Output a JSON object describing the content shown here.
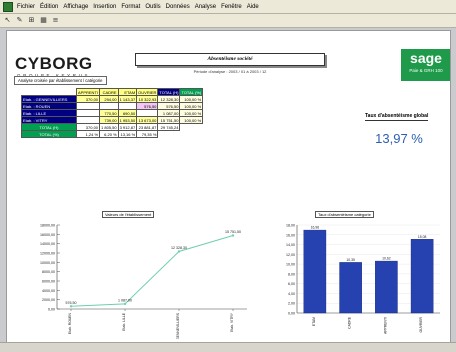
{
  "menu": {
    "items": [
      "Fichier",
      "Édition",
      "Affichage",
      "Insertion",
      "Format",
      "Outils",
      "Données",
      "Analyse",
      "Fenêtre",
      "Aide"
    ]
  },
  "toolbar": {
    "icons": [
      "pointer-icon",
      "draw-icon",
      "crop-icon",
      "grid-icon",
      "format-icon"
    ]
  },
  "logo": {
    "main": "CYBORG",
    "sub": "GROUPE KEYRUS"
  },
  "subtitle_box": "Analyse croisée par établissement / catégorie",
  "title": "Absentéisme société",
  "period": "Période d'analyse : 2003 / 01 à 2003 / 12",
  "sage": {
    "brand": "sage",
    "sub": "Paie & GRH 100"
  },
  "table": {
    "headers": [
      "APPRENTI",
      "CADRE",
      "ETAM",
      "OUVRIER",
      "TOTAL (H)",
      "TOTAL (%)"
    ],
    "rows": [
      {
        "label": "Etab. : GENNEVILLIERS",
        "cells": [
          "370,00",
          "294,00",
          "1 143,37",
          "10 322,93",
          "12 328,30",
          "100,00 %"
        ]
      },
      {
        "label": "Etab. : ROUEN",
        "cells": [
          "",
          "",
          "",
          "576,50",
          "576,50",
          "100,00 %"
        ]
      },
      {
        "label": "Etab. : LILLE",
        "cells": [
          "",
          "770,50",
          "690,50",
          "",
          "1 087,00",
          "100,00 %"
        ]
      },
      {
        "label": "Etab. : VITRY",
        "cells": [
          "",
          "739,00",
          "1 953,50",
          "13 673,00",
          "15 751,50",
          "100,00 %"
        ]
      }
    ],
    "total_h": {
      "label": "TOTAL (H)",
      "cells": [
        "370,00",
        "1 805,50",
        "3 912,87",
        "23 881,87",
        "29 745,24"
      ]
    },
    "total_pct": {
      "label": "TOTAL (%)",
      "cells": [
        "1,24 %",
        "6,20 %",
        "13,16 %",
        "79,35 %"
      ]
    }
  },
  "taux": {
    "label": "Taux d'absentéisme global",
    "value": "13,97 %"
  },
  "chart_data": [
    {
      "type": "line",
      "title": "Valeurs de l'établissement",
      "categories": [
        "Etab. ROUEN",
        "Etab. LILLE",
        "Etab. GENNEVILLIERS",
        "Etab. VITRY"
      ],
      "values": [
        576.5,
        1087,
        12328.3,
        15751.5
      ],
      "data_labels": [
        "576,50",
        "1 087,00",
        "12 328,30",
        "15 751,50"
      ],
      "yticks": [
        "18000,00",
        "16000,00",
        "14000,00",
        "12000,00",
        "10000,00",
        "8000,00",
        "6000,00",
        "4000,00",
        "2000,00",
        "0,00"
      ],
      "ylim": [
        0,
        18000
      ],
      "color": "#6fcfb0"
    },
    {
      "type": "bar",
      "title": "Taux d'absentéisme catégorie",
      "categories": [
        "ETAM",
        "CADRE",
        "APPRENTI",
        "OUVRIER"
      ],
      "values": [
        16.96,
        10.35,
        10.62,
        15.08
      ],
      "data_labels": [
        "16,96",
        "10,35",
        "10,62",
        "15,08"
      ],
      "yticks": [
        "18,00",
        "16,00",
        "14,00",
        "12,00",
        "10,00",
        "8,00",
        "6,00",
        "4,00",
        "2,00",
        "0,00"
      ],
      "ylim": [
        0,
        18
      ],
      "color": "#2542b0"
    }
  ]
}
